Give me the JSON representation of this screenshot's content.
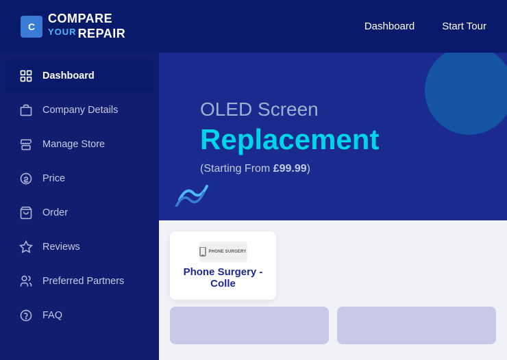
{
  "header": {
    "logo_line1": "COMPARE",
    "logo_line2": "YOUR",
    "logo_line3": "REPAIR",
    "logo_icon": "C",
    "nav": {
      "dashboard_label": "Dashboard",
      "start_tour_label": "Start Tour"
    }
  },
  "sidebar": {
    "items": [
      {
        "id": "dashboard",
        "label": "Dashboard",
        "icon": "dashboard",
        "active": true
      },
      {
        "id": "company-details",
        "label": "Company Details",
        "icon": "company",
        "active": false
      },
      {
        "id": "manage-store",
        "label": "Manage Store",
        "icon": "store",
        "active": false
      },
      {
        "id": "price",
        "label": "Price",
        "icon": "price",
        "active": false
      },
      {
        "id": "order",
        "label": "Order",
        "icon": "order",
        "active": false
      },
      {
        "id": "reviews",
        "label": "Reviews",
        "icon": "reviews",
        "active": false
      },
      {
        "id": "preferred-partners",
        "label": "Preferred Partners",
        "icon": "partners",
        "active": false
      },
      {
        "id": "faq",
        "label": "FAQ",
        "icon": "faq",
        "active": false
      }
    ]
  },
  "banner": {
    "subtitle": "OLED Screen",
    "title": "Replacement",
    "price_text": "(Starting From ",
    "price_value": "£99.99",
    "price_close": ")"
  },
  "store_card": {
    "logo_text": "PHONE SURGERY",
    "name": "Phone Surgery - Colle"
  },
  "colors": {
    "accent": "#00d4e8",
    "dark_blue": "#0a1a6b",
    "sidebar_bg": "#111d6e",
    "banner_bg": "#1a2a8f"
  }
}
